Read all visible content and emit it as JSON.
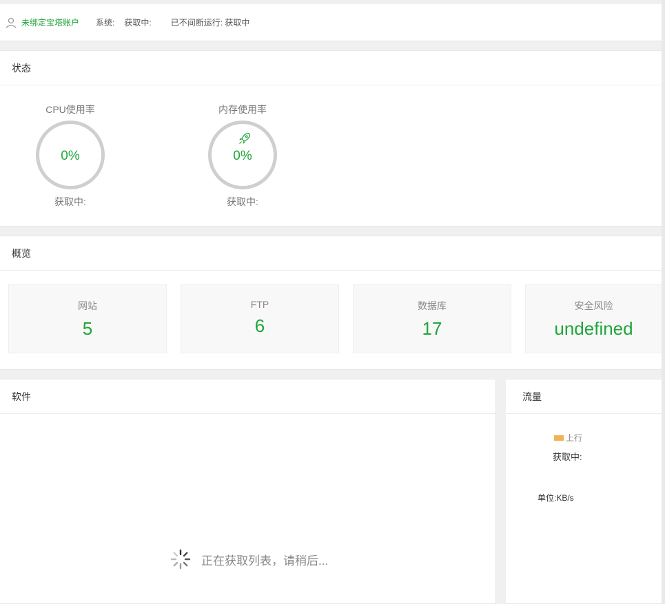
{
  "topbar": {
    "account_label": "未绑定宝塔账户",
    "system_label": "系统:",
    "system_value": "获取中:",
    "uptime": "已不间断运行: 获取中"
  },
  "status": {
    "title": "状态",
    "cpu": {
      "label": "CPU使用率",
      "value": "0%",
      "sub": "获取中:"
    },
    "memory": {
      "label": "内存使用率",
      "value": "0%",
      "sub": "获取中:"
    }
  },
  "overview": {
    "title": "概览",
    "items": [
      {
        "label": "网站",
        "value": "5"
      },
      {
        "label": "FTP",
        "value": "6"
      },
      {
        "label": "数据库",
        "value": "17"
      },
      {
        "label": "安全风险",
        "value": "undefined"
      }
    ]
  },
  "software": {
    "title": "软件",
    "loading_text": "正在获取列表，请稍后..."
  },
  "traffic": {
    "title": "流量",
    "legend_up": "上行",
    "status": "获取中:",
    "unit": "单位:KB/s"
  },
  "colors": {
    "accent": "#20a53a",
    "upstream": "#f0b457"
  },
  "icons": {
    "account": "user-icon",
    "memory": "rocket-icon",
    "loading": "spinner-icon"
  }
}
